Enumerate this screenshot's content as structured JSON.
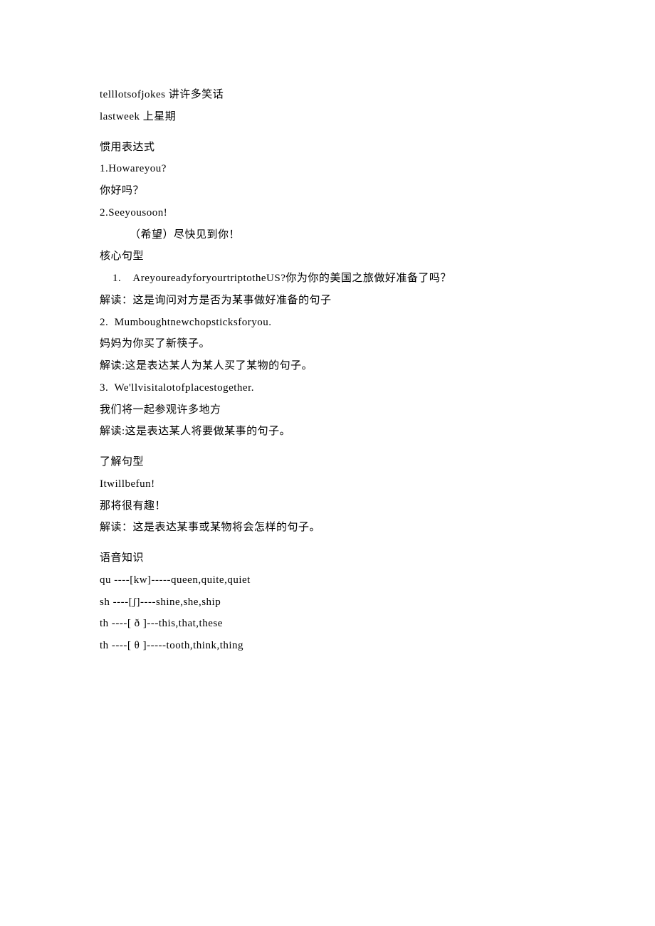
{
  "vocab": [
    "telllotsofjokes 讲许多笑话",
    "lastweek 上星期"
  ],
  "idiom": {
    "heading": "惯用表达式",
    "items": [
      {
        "num": "1.Howareyou?",
        "cn": "你好吗？"
      },
      {
        "num": "2.Seeyousoon!",
        "cn": "（希望）尽快见到你！",
        "cn_indent": true
      }
    ]
  },
  "core": {
    "heading": "核心句型",
    "rows": [
      "1.    AreyoureadyforyourtriptotheUS?你为你的美国之旅做好准备了吗？",
      "解读：这是询问对方是否为某事做好准备的句子",
      "2.  Mumboughtnewchopsticksforyou.",
      "妈妈为你买了新筷子。",
      "解读:这是表达某人为某人买了某物的句子。",
      "3.  We'llvisitalotofplacestogether.",
      "我们将一起参观许多地方",
      "解读:这是表达某人将要做某事的句子。"
    ]
  },
  "learn": {
    "heading": "了解句型",
    "rows": [
      "Itwillbefun!",
      "那将很有趣！",
      "解读：这是表达某事或某物将会怎样的句子。"
    ]
  },
  "phon": {
    "heading": "语音知识",
    "rows": [
      "qu ----[kw]-----queen,quite,quiet",
      "sh ----[ʃ]----shine,she,ship",
      "th ----[ ð ]---this,that,these",
      "th ----[ θ ]-----tooth,think,thing"
    ]
  }
}
